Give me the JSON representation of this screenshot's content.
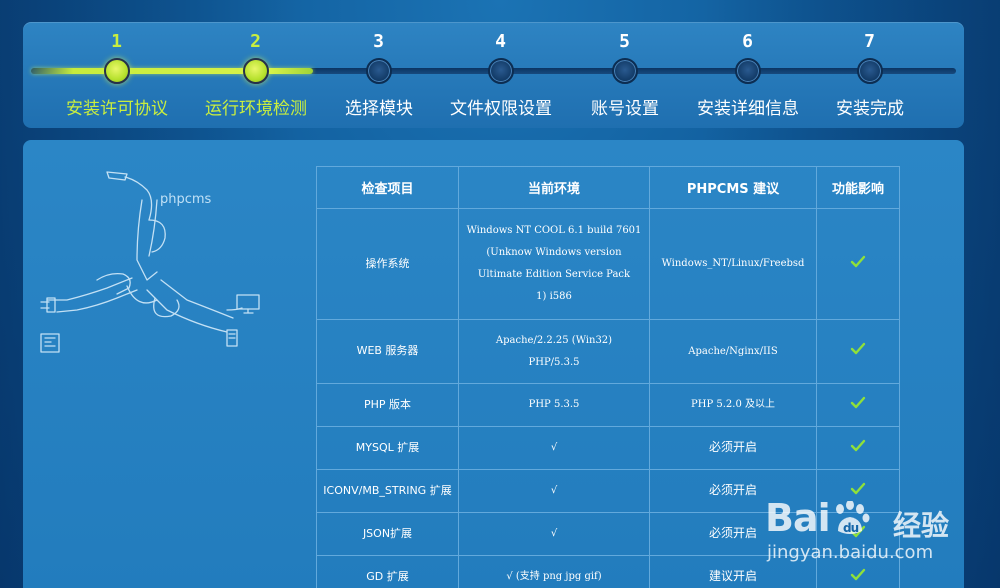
{
  "steps": [
    {
      "num": "1",
      "label": "安装许可协议",
      "done": true
    },
    {
      "num": "2",
      "label": "运行环境检测",
      "done": true
    },
    {
      "num": "3",
      "label": "选择模块",
      "done": false
    },
    {
      "num": "4",
      "label": "文件权限设置",
      "done": false
    },
    {
      "num": "5",
      "label": "账号设置",
      "done": false
    },
    {
      "num": "6",
      "label": "安装详细信息",
      "done": false
    },
    {
      "num": "7",
      "label": "安装完成",
      "done": false
    }
  ],
  "logo": {
    "text": "phpcms"
  },
  "table": {
    "headers": [
      "检查项目",
      "当前环境",
      "PHPCMS 建议",
      "功能影响"
    ],
    "rows": [
      {
        "item": "操作系统",
        "current": [
          "Windows NT COOL 6.1 build 7601",
          "(Unknow Windows version",
          "Ultimate Edition Service Pack",
          "1) i586"
        ],
        "suggest": "Windows_NT/Linux/Freebsd"
      },
      {
        "item": "WEB 服务器",
        "current": [
          "Apache/2.2.25 (Win32)",
          "PHP/5.3.5"
        ],
        "suggest": "Apache/Nginx/IIS"
      },
      {
        "item": "PHP 版本",
        "current": [
          "PHP 5.3.5"
        ],
        "suggest": "PHP 5.2.0 及以上"
      },
      {
        "item": "MYSQL 扩展",
        "current": [
          "√"
        ],
        "suggest": "必须开启"
      },
      {
        "item": "ICONV/MB_STRING 扩展",
        "current": [
          "√"
        ],
        "suggest": "必须开启"
      },
      {
        "item": "JSON扩展",
        "current": [
          "√"
        ],
        "suggest": "必须开启"
      },
      {
        "item": "GD 扩展",
        "current": [
          "√ (支持 png jpg gif)"
        ],
        "suggest": "建议开启"
      }
    ]
  },
  "colors": {
    "accent": "#c9ee3f",
    "check": "#8fe03a"
  },
  "watermark": {
    "brand": "Bai",
    "brand2": "经验",
    "url": "jingyan.baidu.com"
  }
}
